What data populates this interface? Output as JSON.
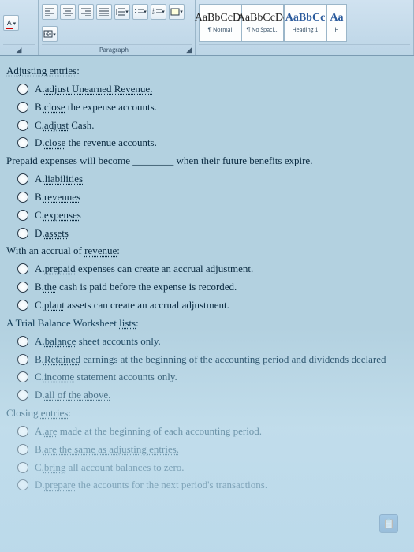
{
  "ribbon": {
    "paragraph_label": "Paragraph",
    "font_letter": "A",
    "styles": [
      {
        "sample": "AaBbCcDc",
        "name": "¶ Normal"
      },
      {
        "sample": "AaBbCcDc",
        "name": "¶ No Spaci..."
      },
      {
        "sample": "AaBbCc",
        "name": "Heading 1"
      },
      {
        "sample": "Aa",
        "name": "H"
      }
    ]
  },
  "questions": [
    {
      "prompt_parts": [
        "Adjusting entries",
        ":"
      ],
      "options": [
        {
          "pre": "A.",
          "u": "adjust Unearned Revenue.",
          "post": ""
        },
        {
          "pre": "B.",
          "u": "close",
          "post": " the expense accounts."
        },
        {
          "pre": "C.",
          "u": "adjust",
          "post": " Cash."
        },
        {
          "pre": "D.",
          "u": "close",
          "post": " the revenue accounts."
        }
      ]
    },
    {
      "prompt_plain": "Prepaid expenses will become ________ when their future benefits expire.",
      "options": [
        {
          "pre": "A.",
          "u": "liabilities",
          "post": ""
        },
        {
          "pre": "B.",
          "u": "revenues",
          "post": ""
        },
        {
          "pre": "C.",
          "u": "expenses",
          "post": ""
        },
        {
          "pre": "D.",
          "u": "assets",
          "post": ""
        }
      ]
    },
    {
      "prompt_parts": [
        "With an accrual of ",
        "revenue",
        ":"
      ],
      "options": [
        {
          "pre": "A.",
          "u": "prepaid",
          "post": " expenses can create an accrual adjustment."
        },
        {
          "pre": "B.",
          "u": "the",
          "post": " cash is paid before the expense is recorded."
        },
        {
          "pre": "C.",
          "u": "plant",
          "post": " assets can create an accrual adjustment."
        }
      ]
    },
    {
      "prompt_parts": [
        "A Trial Balance Worksheet ",
        "lists",
        ":"
      ],
      "options": [
        {
          "pre": "A.",
          "u": "balance",
          "post": " sheet accounts only."
        },
        {
          "pre": "B.",
          "u": "Retained",
          "post": " earnings at the beginning of the accounting period and dividends declared"
        },
        {
          "pre": "C.",
          "u": "income",
          "post": " statement accounts only."
        },
        {
          "pre": "D.",
          "u": "all of the above.",
          "post": ""
        }
      ]
    },
    {
      "prompt_parts": [
        "Closing ",
        "entries",
        ":"
      ],
      "options": [
        {
          "pre": "A.",
          "u": "are",
          "post": " made at the beginning of each accounting period."
        },
        {
          "pre": "B.",
          "u": "are the same as adjusting entries.",
          "post": ""
        },
        {
          "pre": "C.",
          "u": "bring",
          "post": " all account balances to zero."
        },
        {
          "pre": "D.",
          "u": "prepare",
          "post": " the accounts for the next period's transactions."
        }
      ]
    }
  ]
}
